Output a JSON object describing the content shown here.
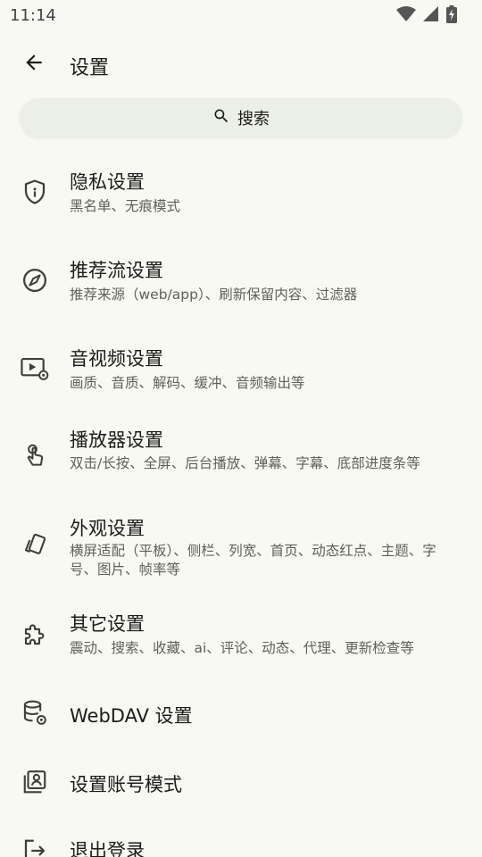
{
  "status_bar": {
    "time": "11:14",
    "icons": [
      "wifi-icon",
      "cell-signal-icon",
      "battery-charging-icon"
    ]
  },
  "app_bar": {
    "back_icon": "arrow-back-icon",
    "title": "设置"
  },
  "search": {
    "icon": "search-icon",
    "label": "搜索"
  },
  "colors": {
    "background": "#f8f9f3",
    "search_background": "#ecefe6",
    "text_primary": "#1b1c18",
    "text_secondary": "#5f6158",
    "icon": "#3d4039"
  },
  "items": [
    {
      "icon": "shield-icon",
      "title": "隐私设置",
      "subtitle": "黑名单、无痕模式"
    },
    {
      "icon": "compass-icon",
      "title": "推荐流设置",
      "subtitle": "推荐来源（web/app）、刷新保留内容、过滤器"
    },
    {
      "icon": "video-settings-icon",
      "title": "音视频设置",
      "subtitle": "画质、音质、解码、缓冲、音频输出等"
    },
    {
      "icon": "touch-app-icon",
      "title": "播放器设置",
      "subtitle": "双击/长按、全屏、后台播放、弹幕、字幕、底部进度条等"
    },
    {
      "icon": "style-cards-icon",
      "title": "外观设置",
      "subtitle": "横屏适配（平板）、侧栏、列宽、首页、动态红点、主题、字号、图片、帧率等"
    },
    {
      "icon": "extension-puzzle-icon",
      "title": "其它设置",
      "subtitle": "震动、搜索、收藏、ai、评论、动态、代理、更新检查等"
    },
    {
      "icon": "database-settings-icon",
      "title": "WebDAV 设置"
    },
    {
      "icon": "account-box-icon",
      "title": "设置账号模式"
    },
    {
      "icon": "logout-icon",
      "title": "退出登录"
    }
  ]
}
